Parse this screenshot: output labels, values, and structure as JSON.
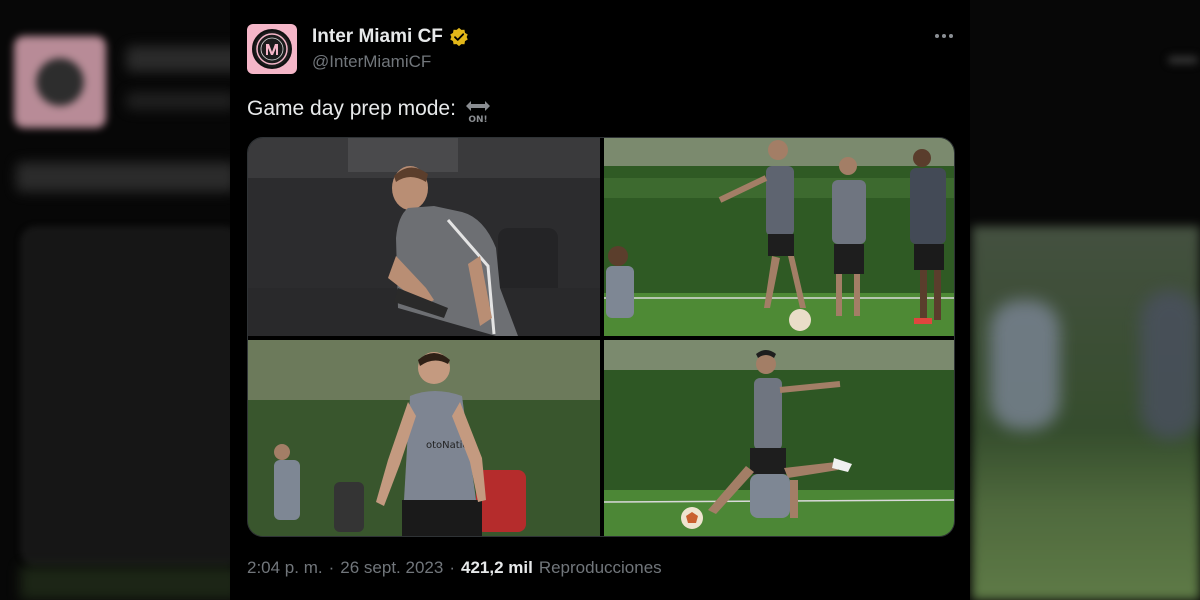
{
  "tweet": {
    "display_name": "Inter Miami CF",
    "handle": "@InterMiamiCF",
    "text": "Game day prep mode:",
    "emoji": "on-arrow-icon",
    "time": "2:04 p. m.",
    "separator": "·",
    "date": "26 sept. 2023",
    "views_count": "421,2 mil",
    "views_label": "Reproducciones",
    "verified_color": "#e2b719",
    "avatar_bg": "#f5b6c8"
  },
  "icons": {
    "verified": "verified-badge-icon",
    "more": "more-options-icon",
    "crest": "inter-miami-crest-icon"
  },
  "media": {
    "photos": [
      {
        "name": "player-dribbling-photo"
      },
      {
        "name": "players-training-field-photo"
      },
      {
        "name": "player-standing-photo"
      },
      {
        "name": "player-kicking-ball-photo"
      }
    ]
  }
}
